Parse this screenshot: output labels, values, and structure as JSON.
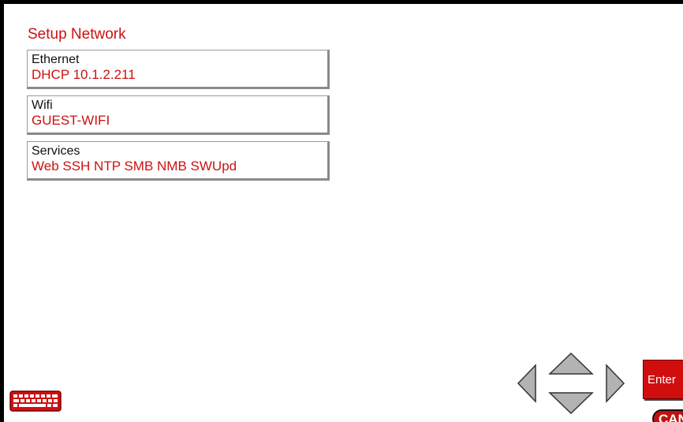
{
  "title": "Setup Network",
  "items": [
    {
      "label": "Ethernet",
      "value": "DHCP 10.1.2.211"
    },
    {
      "label": "Wifi",
      "value": "GUEST-WIFI"
    },
    {
      "label": "Services",
      "value": "Web SSH NTP SMB NMB SWUpd"
    }
  ],
  "controls": {
    "enter_label": "Enter",
    "cancel_label": "CAN"
  },
  "icons": {
    "keyboard": "keyboard-icon",
    "left": "arrow-left-icon",
    "up": "arrow-up-icon",
    "down": "arrow-down-icon",
    "right": "arrow-right-icon"
  },
  "colors": {
    "accent": "#cc1111",
    "button_red": "#d10e0e",
    "arrow_gray": "#b3b3b3"
  }
}
